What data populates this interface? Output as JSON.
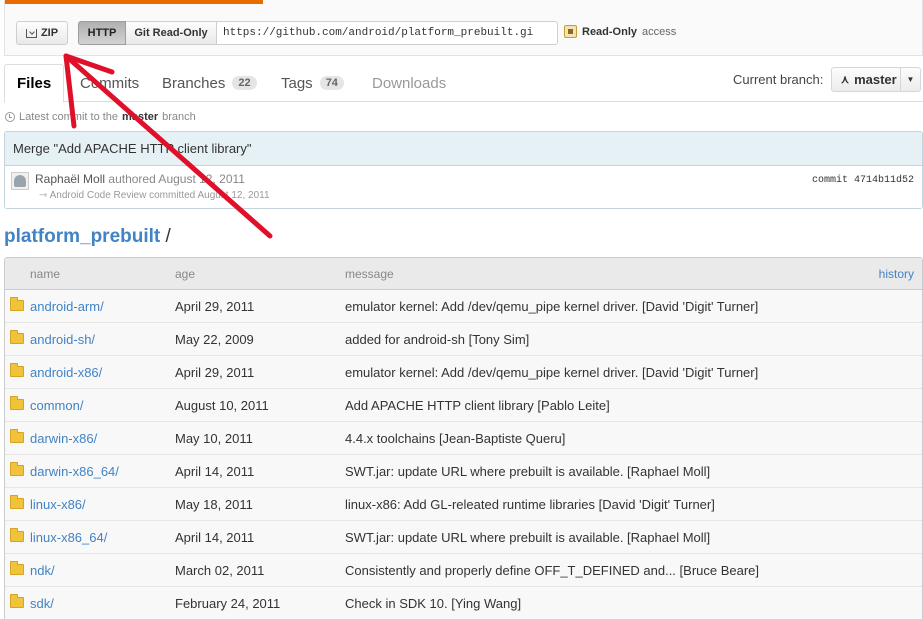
{
  "clone": {
    "zip_label": "ZIP",
    "http_label": "HTTP",
    "git_label": "Git Read-Only",
    "url": "https://github.com/android/platform_prebuilt.gi",
    "access_strong": "Read-Only",
    "access_rest": "access"
  },
  "tabs": {
    "files": "Files",
    "commits": "Commits",
    "branches": "Branches",
    "branches_count": "22",
    "tags": "Tags",
    "tags_count": "74",
    "downloads": "Downloads"
  },
  "branch": {
    "label": "Current branch:",
    "name": "master"
  },
  "latest": {
    "prefix": "Latest commit to the",
    "branch": "master",
    "suffix": "branch"
  },
  "commit": {
    "message": "Merge \"Add APACHE HTTP client library\"",
    "author": "Raphaël Moll",
    "authored": "authored August 12, 2011",
    "committer_line": "Android Code Review committed August 12, 2011",
    "sha_label": "commit",
    "sha": "4714b11d52"
  },
  "path": {
    "repo": "platform_prebuilt",
    "sep": " /"
  },
  "tree": {
    "headers": {
      "name": "name",
      "age": "age",
      "message": "message",
      "history": "history"
    },
    "rows": [
      {
        "name": "android-arm/",
        "age": "April 29, 2011",
        "message": "emulator kernel: Add /dev/qemu_pipe kernel driver. [David 'Digit' Turner]"
      },
      {
        "name": "android-sh/",
        "age": "May 22, 2009",
        "message": "added for android-sh [Tony Sim]"
      },
      {
        "name": "android-x86/",
        "age": "April 29, 2011",
        "message": "emulator kernel: Add /dev/qemu_pipe kernel driver. [David 'Digit' Turner]"
      },
      {
        "name": "common/",
        "age": "August 10, 2011",
        "message": "Add APACHE HTTP client library [Pablo Leite]"
      },
      {
        "name": "darwin-x86/",
        "age": "May 10, 2011",
        "message": "4.4.x toolchains [Jean-Baptiste Queru]"
      },
      {
        "name": "darwin-x86_64/",
        "age": "April 14, 2011",
        "message": "SWT.jar: update URL where prebuilt is available. [Raphael Moll]"
      },
      {
        "name": "linux-x86/",
        "age": "May 18, 2011",
        "message": "linux-x86: Add GL-releated runtime libraries [David 'Digit' Turner]"
      },
      {
        "name": "linux-x86_64/",
        "age": "April 14, 2011",
        "message": "SWT.jar: update URL where prebuilt is available. [Raphael Moll]"
      },
      {
        "name": "ndk/",
        "age": "March 02, 2011",
        "message": "Consistently and properly define OFF_T_DEFINED and... [Bruce Beare]"
      },
      {
        "name": "sdk/",
        "age": "February 24, 2011",
        "message": "Check in SDK 10. [Ying Wang]"
      }
    ]
  },
  "colors": {
    "link": "#4183c4",
    "annotation_arrow": "#e0102a",
    "accent": "#e86b00"
  },
  "icons": [
    "zip-icon",
    "lock-icon",
    "branch-icon",
    "chevron-down-icon",
    "clock-icon",
    "avatar",
    "folder-icon"
  ]
}
